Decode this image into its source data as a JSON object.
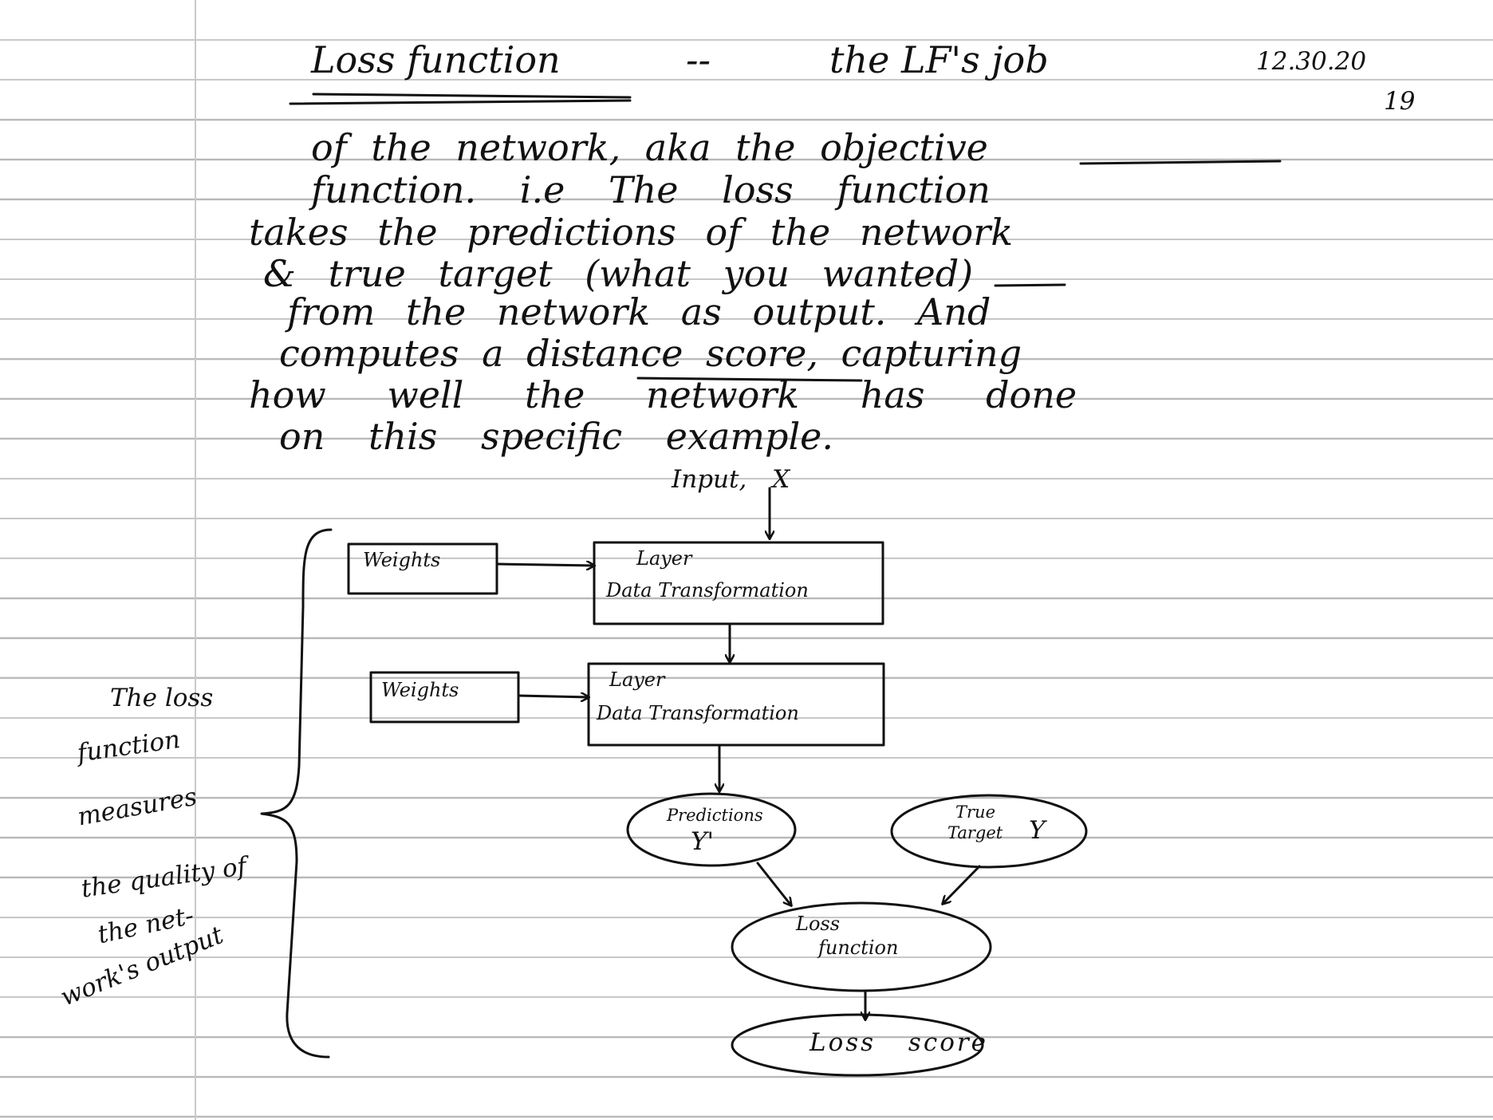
{
  "colors": {
    "paper": "#ffffff",
    "ruled_line": "#b8b8b8",
    "margin_line": "#c9c9c9",
    "ink": "#111111"
  },
  "header": {
    "title": "Loss function",
    "dashes": "--",
    "continuation": "the LF's job",
    "date": "12.30.20",
    "date_year": "19"
  },
  "body_lines": [
    "of the network, aka the objective",
    "function. i.e The loss function",
    "takes the predictions of the network",
    "& true target (what you wanted)",
    "from the network as output. And",
    "computes a distance score, capturing",
    "how well the network has done",
    "on this specific example."
  ],
  "diagram": {
    "input_label": "Input, X",
    "layer1": {
      "weights": "Weights",
      "title": "Layer",
      "subtitle": "Data Transformation"
    },
    "layer2": {
      "weights": "Weights",
      "title": "Layer",
      "subtitle": "Data Transformation"
    },
    "predictions": {
      "label": "Predictions",
      "symbol": "Y'"
    },
    "true_target": {
      "label_line1": "True",
      "label_line2": "Target",
      "symbol": "Y"
    },
    "loss_function": {
      "line1": "Loss",
      "line2": "function"
    },
    "loss_score": "Loss score"
  },
  "side_note": [
    "The loss",
    "function",
    "measures",
    "the quality of",
    "the net-",
    "work's output"
  ]
}
